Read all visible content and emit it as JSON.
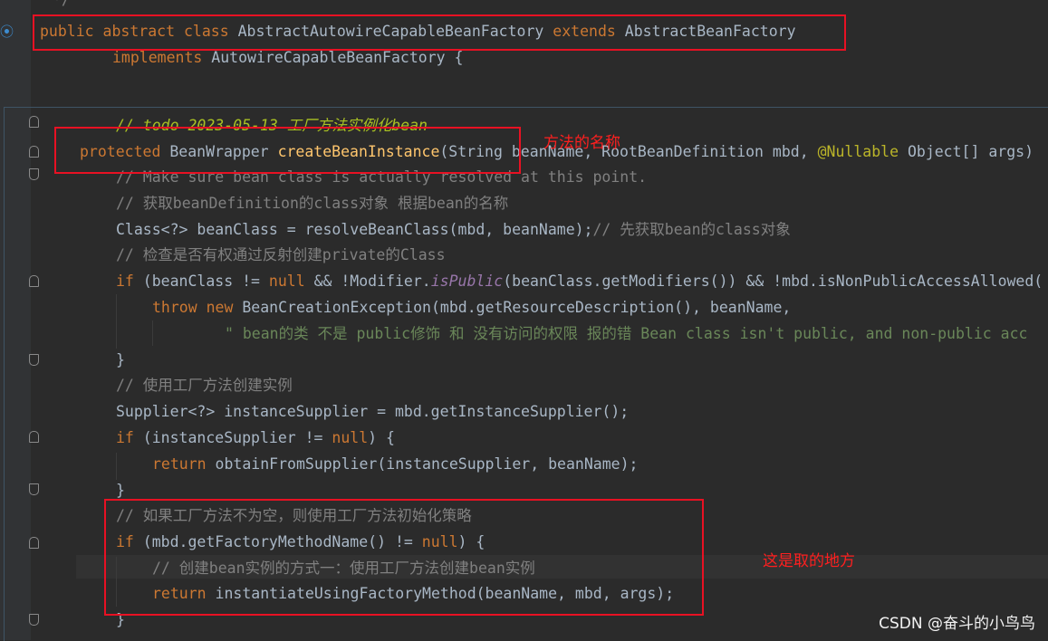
{
  "code": {
    "top_comment": "*/",
    "class_decl": {
      "public": "public",
      "abstract": "abstract",
      "class": "class",
      "name": "AbstractAutowireCapableBeanFactory",
      "extends": "extends",
      "parent": "AbstractBeanFactory"
    },
    "implements_line": {
      "implements": "implements",
      "iface": "AutowireCapableBeanFactory {"
    },
    "todo": "// todo 2023-05-13 工厂方法实例化bean",
    "method": {
      "protected": "protected",
      "ret": "BeanWrapper",
      "name": "createBeanInstance",
      "open": "(String beanName, RootBeanDefinition mbd, ",
      "annotation": "@Nullable",
      "rest": " Object[] args)"
    },
    "c1": "// Make sure bean class is actually resolved at this point.",
    "c2": "// 获取beanDefinition的class对象 根据bean的名称",
    "l_beanclass": "Class<?> beanClass = resolveBeanClass(mbd, beanName);",
    "l_beanclass_cm": "// 先获取bean的class对象",
    "c3": "// 检查是否有权通过反射创建private的Class",
    "if1": {
      "if": "if",
      "a": " (beanClass != ",
      "null": "null",
      "b": " && !Modifier.",
      "ispublic": "isPublic",
      "c": "(beanClass.getModifiers()) && !mbd.isNonPublicAccessAllowed("
    },
    "throw_line": {
      "throw": "throw",
      "new": "new",
      "rest": " BeanCreationException(mbd.getResourceDescription(), beanName,"
    },
    "str_line": "\" bean的类 不是 public修饰 和 没有访问的权限 报的错 Bean class isn't public, and non-public acc",
    "brace": "}",
    "c4": "// 使用工厂方法创建实例",
    "supplier_line": "Supplier<?> instanceSupplier = mbd.getInstanceSupplier();",
    "if2": {
      "if": "if",
      "a": " (instanceSupplier != ",
      "null": "null",
      "b": ") {"
    },
    "return1": {
      "return": "return",
      "rest": " obtainFromSupplier(instanceSupplier, beanName);"
    },
    "c5": "// 如果工厂方法不为空，则使用工厂方法初始化策略",
    "if3": {
      "if": "if",
      "a": " (mbd.getFactoryMethodName() != ",
      "null": "null",
      "b": ") {"
    },
    "c6": "// 创建bean实例的方式一：使用工厂方法创建bean实例",
    "return2": {
      "return": "return",
      "rest": " instantiateUsingFactoryMethod(beanName, mbd, args);"
    }
  },
  "annotations": {
    "method_name": "方法的名称",
    "here": "这是取的地方"
  },
  "watermark": "CSDN @奋斗的小鸟鸟",
  "colors": {
    "keyword": "#cc7832",
    "comment": "#808080",
    "function": "#ffc66d",
    "string": "#6a8759",
    "annotation": "#bbb529",
    "highlight_box": "#e81123"
  }
}
